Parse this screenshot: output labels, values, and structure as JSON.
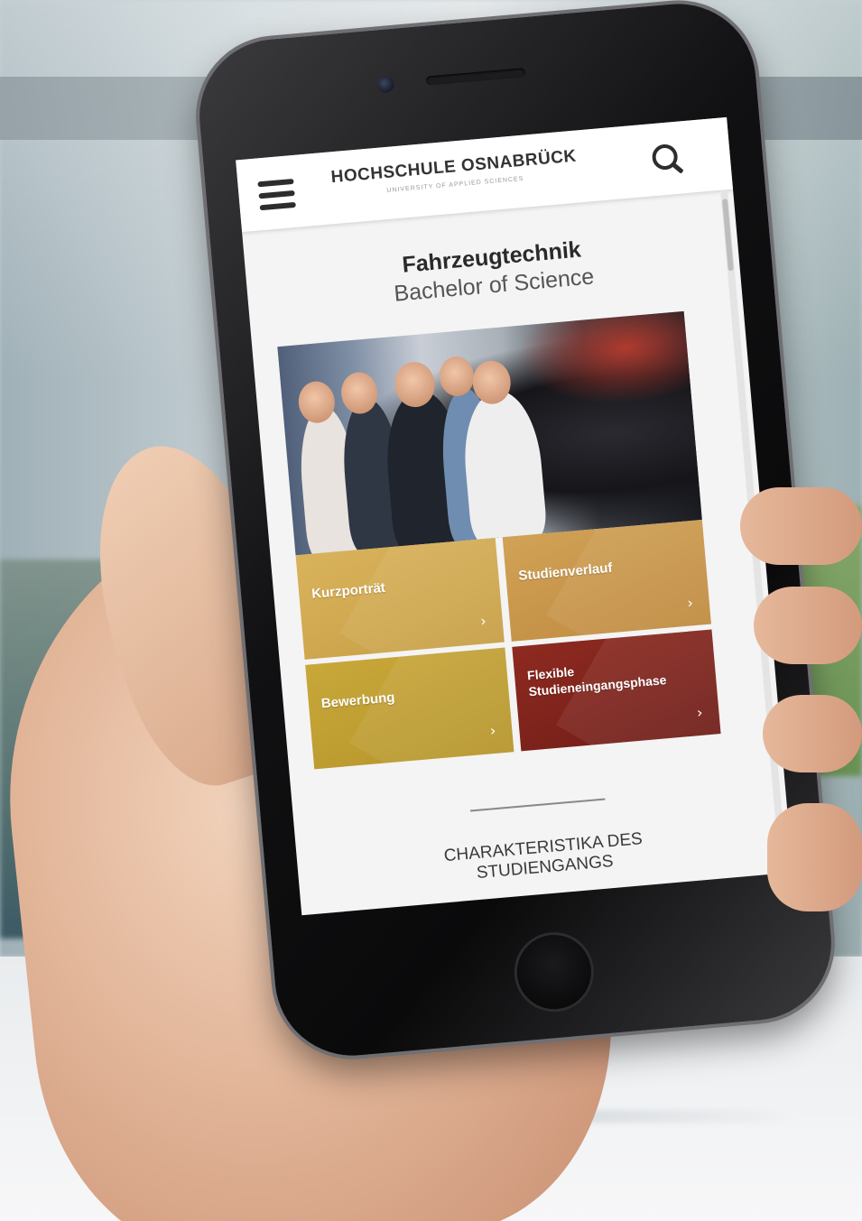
{
  "header": {
    "brand_name": "HOCHSCHULE OSNABRÜCK",
    "brand_tagline": "UNIVERSITY OF APPLIED SCIENCES"
  },
  "icons": {
    "menu": "hamburger-menu-icon",
    "search": "search-icon",
    "tile_arrow": "chevron-right-icon"
  },
  "page": {
    "title": "Fahrzeugtechnik",
    "subtitle": "Bachelor of Science"
  },
  "tiles": [
    {
      "label": "Kurzporträt",
      "arrow": "›",
      "color": "#d4ad55"
    },
    {
      "label": "Studienverlauf",
      "arrow": "›",
      "color": "#cc9d50"
    },
    {
      "label": "Bewerbung",
      "arrow": "›",
      "color": "#c3a235"
    },
    {
      "label": "Flexible Studieneingangsphase",
      "arrow": "›",
      "color": "#82251d"
    }
  ],
  "section": {
    "heading": "CHARAKTERISTIKA DES STUDIENGANGS"
  }
}
